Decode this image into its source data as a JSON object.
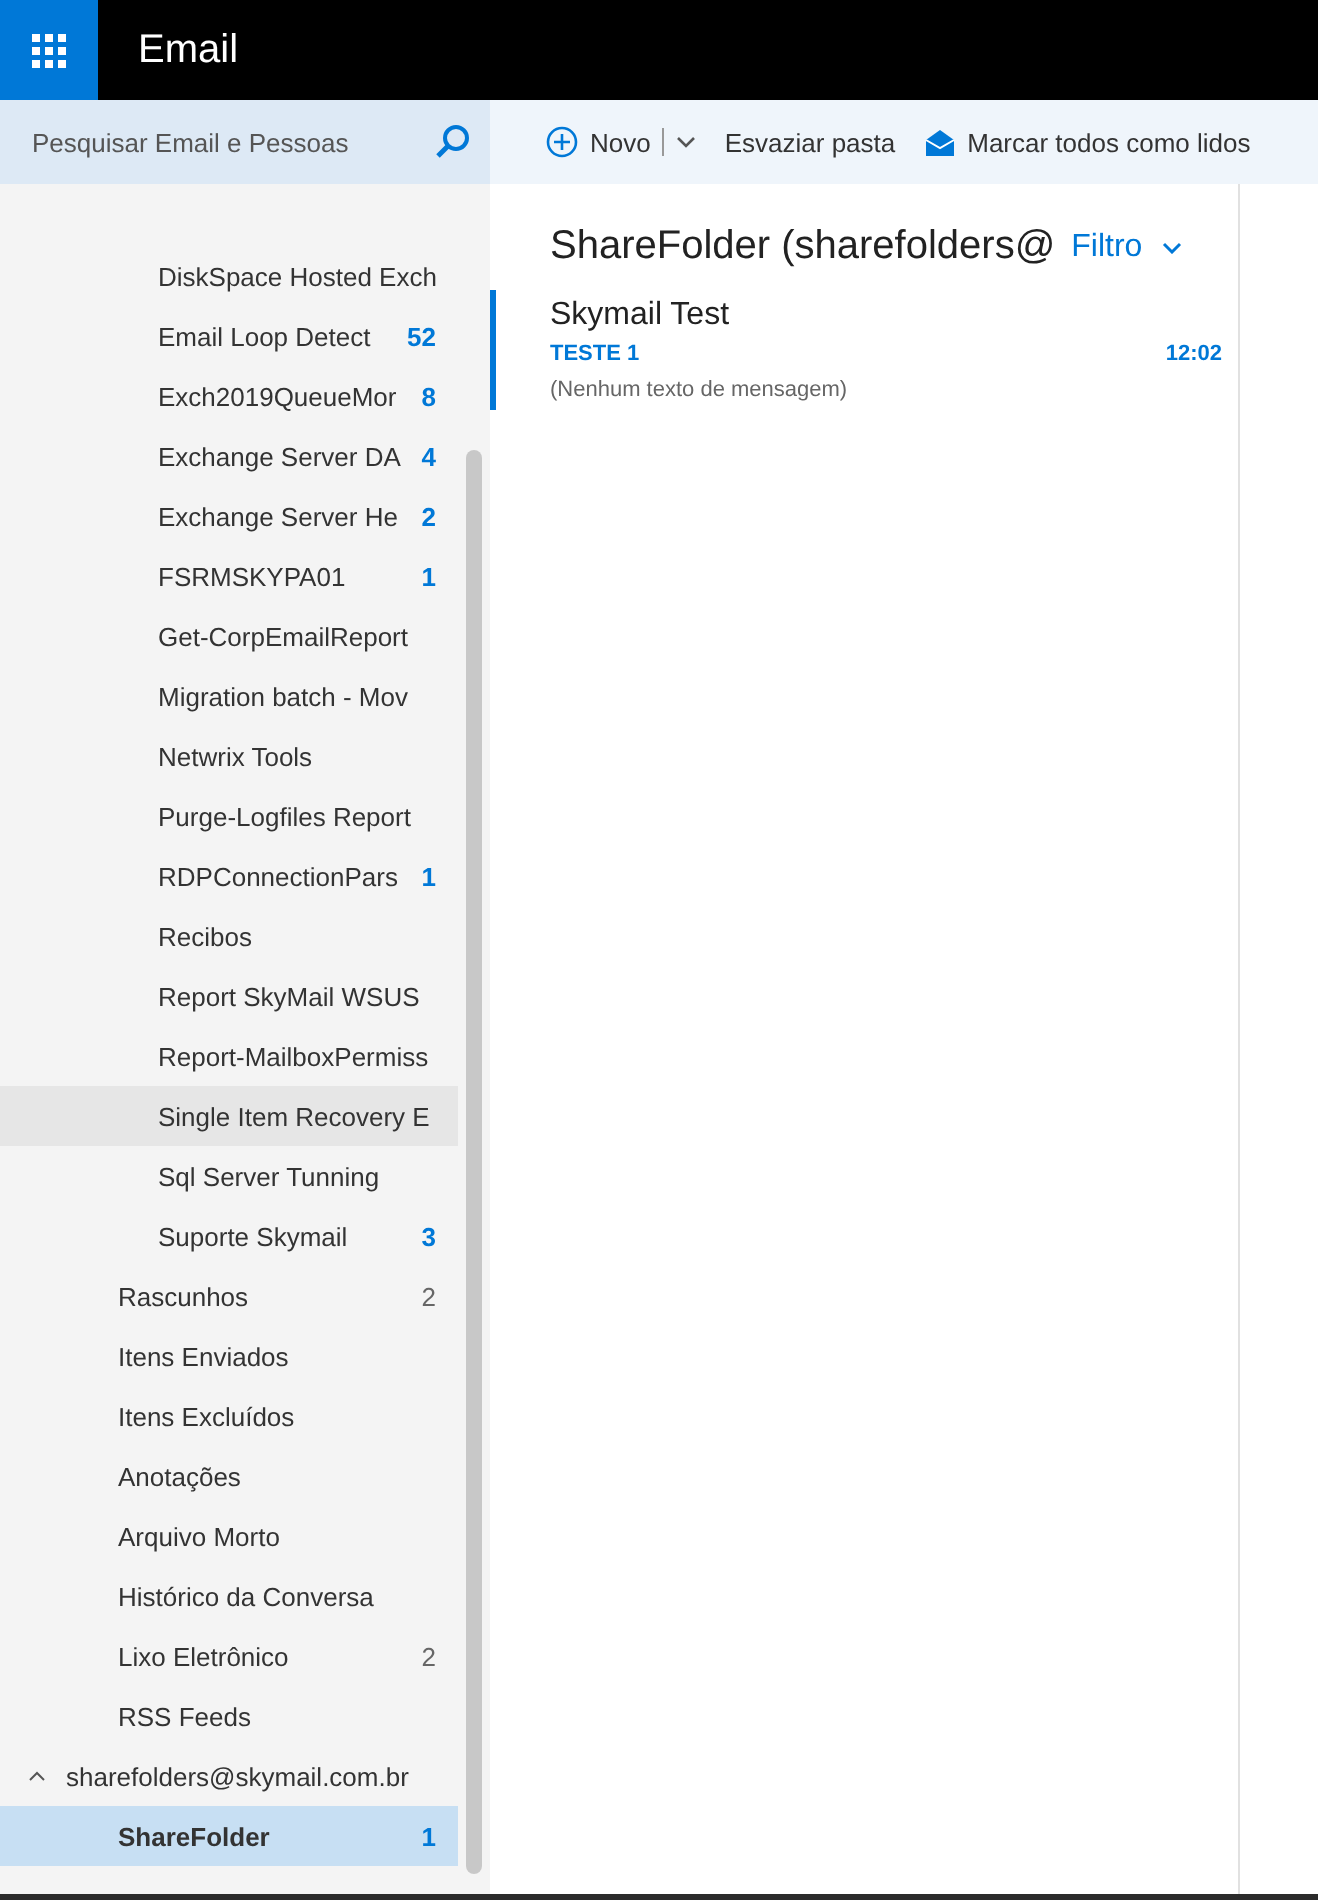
{
  "header": {
    "title": "Email"
  },
  "search": {
    "placeholder": "Pesquisar Email e Pessoas"
  },
  "toolbar": {
    "new_label": "Novo",
    "items": [
      {
        "label": "Esvaziar pasta",
        "kind": "text"
      },
      {
        "label": "Marcar todos como lidos",
        "kind": "envelope"
      }
    ]
  },
  "folders": [
    {
      "label": "DiskSpace Hosted Exch",
      "kind": "subfolder",
      "selected": false,
      "hovered": false
    },
    {
      "label": "Email Loop Detect",
      "count": "52",
      "count_unread": true,
      "kind": "subfolder",
      "selected": false,
      "hovered": false
    },
    {
      "label": "Exch2019QueueMor",
      "count": "8",
      "count_unread": true,
      "kind": "subfolder",
      "selected": false,
      "hovered": false
    },
    {
      "label": "Exchange Server DA",
      "count": "4",
      "count_unread": true,
      "kind": "subfolder",
      "selected": false,
      "hovered": false
    },
    {
      "label": "Exchange Server He",
      "count": "2",
      "count_unread": true,
      "kind": "subfolder",
      "selected": false,
      "hovered": false
    },
    {
      "label": "FSRMSKYPA01",
      "count": "1",
      "count_unread": true,
      "kind": "subfolder",
      "selected": false,
      "hovered": false
    },
    {
      "label": "Get-CorpEmailReport",
      "kind": "subfolder",
      "selected": false,
      "hovered": false
    },
    {
      "label": "Migration batch - Mov",
      "kind": "subfolder",
      "selected": false,
      "hovered": false
    },
    {
      "label": "Netwrix Tools",
      "kind": "subfolder",
      "selected": false,
      "hovered": false
    },
    {
      "label": "Purge-Logfiles Report",
      "kind": "subfolder",
      "selected": false,
      "hovered": false
    },
    {
      "label": "RDPConnectionPars",
      "count": "1",
      "count_unread": true,
      "kind": "subfolder",
      "selected": false,
      "hovered": false
    },
    {
      "label": "Recibos",
      "kind": "subfolder",
      "selected": false,
      "hovered": false
    },
    {
      "label": "Report SkyMail WSUS",
      "kind": "subfolder",
      "selected": false,
      "hovered": false
    },
    {
      "label": "Report-MailboxPermiss",
      "kind": "subfolder",
      "selected": false,
      "hovered": false
    },
    {
      "label": "Single Item Recovery E",
      "kind": "subfolder",
      "selected": false,
      "hovered": true
    },
    {
      "label": "Sql Server Tunning",
      "kind": "subfolder",
      "selected": false,
      "hovered": false
    },
    {
      "label": "Suporte Skymail",
      "count": "3",
      "count_unread": true,
      "kind": "subfolder",
      "selected": false,
      "hovered": false
    },
    {
      "label": "Rascunhos",
      "count": "2",
      "count_unread": false,
      "kind": "folder",
      "selected": false,
      "hovered": false
    },
    {
      "label": "Itens Enviados",
      "kind": "folder",
      "selected": false,
      "hovered": false
    },
    {
      "label": "Itens Excluídos",
      "kind": "folder",
      "selected": false,
      "hovered": false
    },
    {
      "label": "Anotações",
      "kind": "folder",
      "selected": false,
      "hovered": false
    },
    {
      "label": "Arquivo Morto",
      "kind": "folder",
      "selected": false,
      "hovered": false
    },
    {
      "label": "Histórico da Conversa",
      "kind": "folder",
      "selected": false,
      "hovered": false
    },
    {
      "label": "Lixo Eletrônico",
      "count": "2",
      "count_unread": false,
      "kind": "folder",
      "selected": false,
      "hovered": false
    },
    {
      "label": "RSS Feeds",
      "kind": "folder",
      "selected": false,
      "hovered": false
    },
    {
      "label": "sharefolders@skymail.com.br",
      "kind": "account",
      "expanded": true,
      "selected": false,
      "hovered": false
    },
    {
      "label": "ShareFolder",
      "count": "1",
      "count_unread": true,
      "kind": "folder",
      "selected": true,
      "hovered": false
    }
  ],
  "message_list": {
    "heading": "ShareFolder (sharefolders@",
    "filter": "Filtro",
    "messages": [
      {
        "sender": "Skymail Test",
        "subject": "TESTE 1",
        "time": "12:02",
        "preview": "(Nenhum texto de mensagem)",
        "unread": true
      }
    ]
  }
}
